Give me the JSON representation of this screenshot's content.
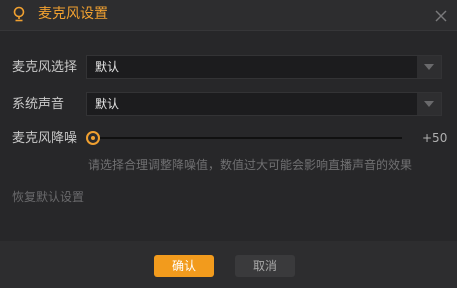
{
  "dialog": {
    "title": "麦克风设置",
    "accent_color": "#f29b1d",
    "icon": "lightbulb-icon",
    "close_icon": "close-icon"
  },
  "settings": {
    "microphone": {
      "label": "麦克风选择",
      "value": "默认"
    },
    "system_sound": {
      "label": "系统声音",
      "value": "默认"
    },
    "noise_reduction": {
      "label": "麦克风降噪",
      "value_text": "+50",
      "value": 0,
      "hint": "请选择合理调整降噪值，数值过大可能会影响直播声音的效果"
    },
    "restore_default_label": "恢复默认设置"
  },
  "footer": {
    "confirm_label": "确认",
    "cancel_label": "取消"
  }
}
